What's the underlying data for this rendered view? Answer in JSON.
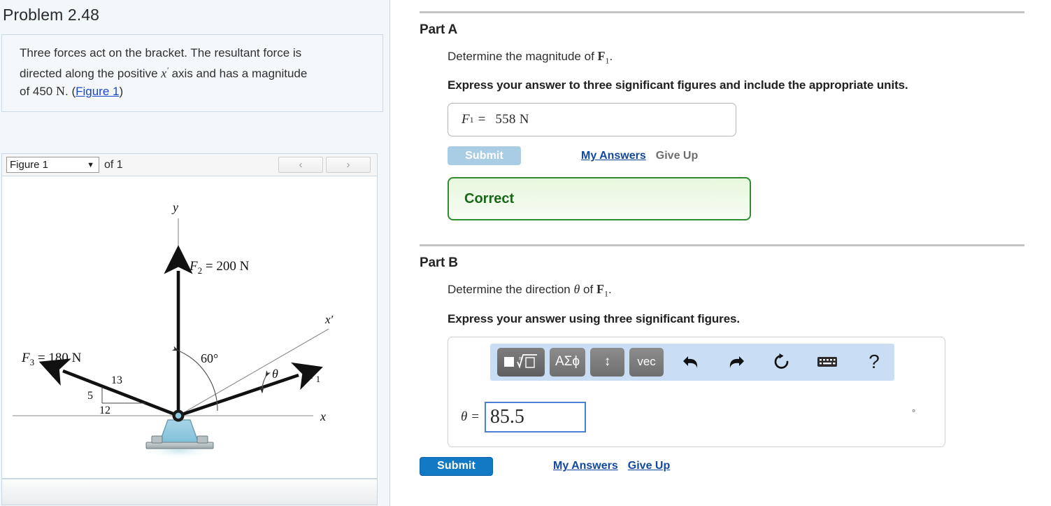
{
  "problem": {
    "title": "Problem 2.48",
    "statement_line1": "Three forces act on the bracket. The resultant force is",
    "statement_line2_a": "directed along the positive ",
    "statement_x": "x",
    "statement_prime": "′",
    "statement_line2_b": " axis and has a magnitude",
    "statement_line3_a": "of 450",
    "statement_unit": "N",
    "statement_line3_b": ". (",
    "figure_link": "Figure 1",
    "statement_line3_c": ")"
  },
  "figure_selector": {
    "selected": "Figure 1",
    "dropdown_arrow": "▼",
    "of_label": "of 1",
    "prev_icon": "‹",
    "next_icon": "›"
  },
  "figure": {
    "axis_y_label": "y",
    "axis_x_label": "x",
    "axis_xprime_label": "x′",
    "f2_label": "F",
    "f2_sub": "2",
    "f2_value": "= 200 N",
    "f3_label": "F",
    "f3_sub": "3",
    "f3_value": "= 180 N",
    "f1_label": "F",
    "f1_sub": "1",
    "angle_60": "60°",
    "angle_theta": "θ",
    "triangle_13": "13",
    "triangle_5": "5",
    "triangle_12": "12"
  },
  "part_a": {
    "heading": "Part A",
    "question_a": "Determine the magnitude of ",
    "question_symbol": "F",
    "question_sub": "1",
    "question_b": ".",
    "instruction": "Express your answer to three significant figures and include the appropriate units.",
    "answer_symbol": "F",
    "answer_sub": "1",
    "answer_equals": "=",
    "answer_value": "558 N",
    "submit_label": "Submit",
    "my_answers_label": "My Answers",
    "give_up_label": "Give Up",
    "feedback": "Correct"
  },
  "part_b": {
    "heading": "Part B",
    "question_a": "Determine the direction ",
    "question_theta": "θ",
    "question_mid": " of ",
    "question_symbol": "F",
    "question_sub": "1",
    "question_b": ".",
    "instruction": "Express your answer using three significant figures.",
    "toolbar": {
      "template_label": "■√□",
      "greek_label": "ΑΣϕ",
      "updown_label": "↕",
      "vec_label": "vec",
      "undo_icon": "undo-arrow",
      "redo_icon": "redo-arrow",
      "reset_icon": "reset-arrow",
      "keyboard_icon": "keyboard",
      "help_label": "?"
    },
    "answer_label": "θ =",
    "answer_value": "85.5",
    "degree_symbol": "°",
    "submit_label": "Submit",
    "my_answers_label": "My Answers",
    "give_up_label": "Give Up"
  },
  "colors": {
    "accent_blue": "#1279c4",
    "disabled_blue": "#a9cde4",
    "link_blue": "#12489c",
    "correct_green": "#186818",
    "correct_border": "#2f8c2f",
    "toolbar_bg": "#c9ddf5",
    "panel_bg": "#f2f7fc"
  }
}
